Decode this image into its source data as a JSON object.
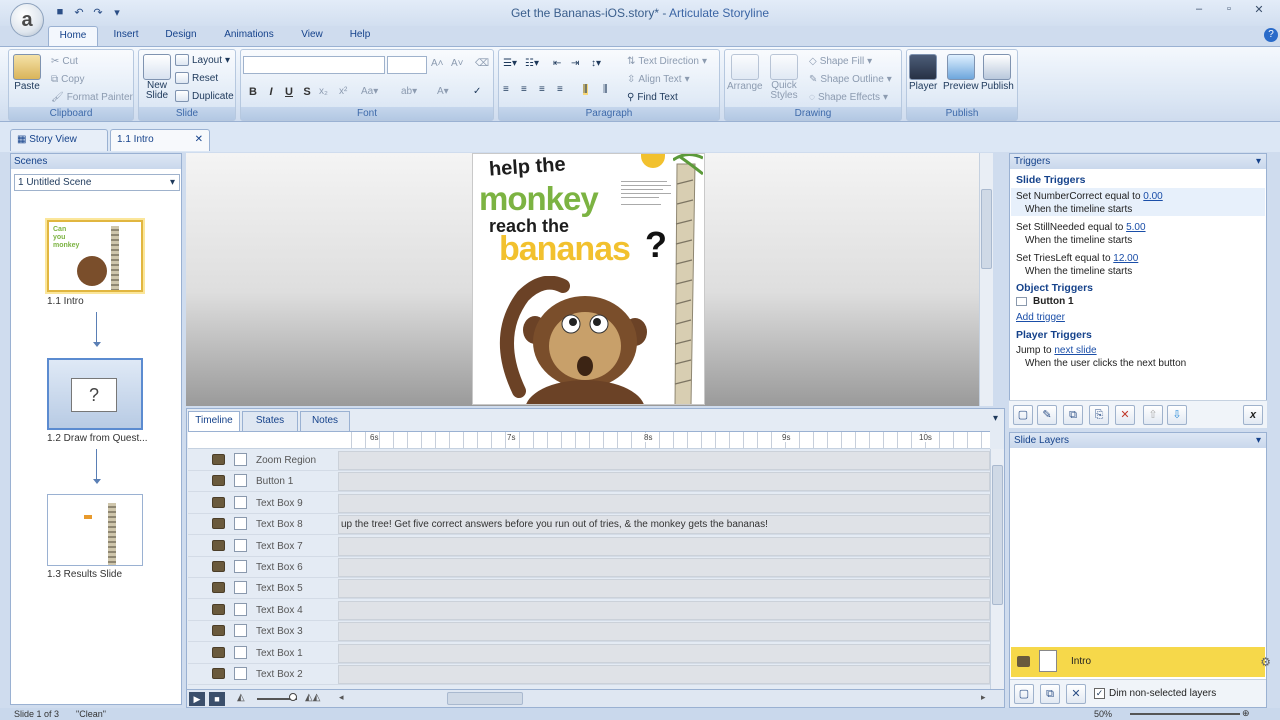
{
  "window": {
    "title": "Get the Bananas-iOS.story* - ",
    "app_name": "Articulate Storyline",
    "controls": [
      "–",
      "▫",
      "✕"
    ]
  },
  "qat": {
    "save_icon": "save-icon",
    "undo_icon": "undo-icon",
    "redo_icon": "redo-icon"
  },
  "ribbon_tabs": [
    "Home",
    "Insert",
    "Design",
    "Animations",
    "View",
    "Help"
  ],
  "ribbon": {
    "clipboard": {
      "paste": "Paste",
      "cut": "Cut",
      "copy": "Copy",
      "format_painter": "Format Painter",
      "group": "Clipboard"
    },
    "slide": {
      "new_slide": "New Slide",
      "layout": "Layout",
      "reset": "Reset",
      "duplicate": "Duplicate",
      "group": "Slide"
    },
    "font": {
      "group": "Font",
      "bold": "B",
      "italic": "I",
      "underline": "U",
      "strike": "S"
    },
    "paragraph": {
      "text_direction": "Text Direction",
      "align_text": "Align Text",
      "find_text": "Find Text",
      "group": "Paragraph"
    },
    "drawing": {
      "arrange": "Arrange",
      "quick_styles": "Quick Styles",
      "shape_fill": "Shape Fill",
      "shape_outline": "Shape Outline",
      "shape_effects": "Shape Effects",
      "group": "Drawing"
    },
    "publish": {
      "player": "Player",
      "preview": "Preview",
      "publish": "Publish",
      "group": "Publish"
    }
  },
  "doc_tabs": {
    "story_view": "Story View",
    "intro": "1.1 Intro"
  },
  "scenes": {
    "header": "Scenes",
    "selected": "1 Untitled Scene",
    "slides": [
      {
        "label": "1.1 Intro"
      },
      {
        "label": "1.2 Draw from Quest..."
      },
      {
        "label": "1.3 Results Slide"
      }
    ]
  },
  "slide_content": {
    "line1": "help the",
    "line2": "monkey",
    "line3": "reach the",
    "line4": "bananas",
    "question_mark": "?"
  },
  "timeline": {
    "tabs": [
      "Timeline",
      "States",
      "Notes"
    ],
    "ruler": [
      "6s",
      "7s",
      "8s",
      "9s",
      "10s"
    ],
    "rows": [
      {
        "name": "Zoom Region",
        "text": ""
      },
      {
        "name": "Button 1",
        "text": ""
      },
      {
        "name": "Text Box 9",
        "text": ""
      },
      {
        "name": "Text Box 8",
        "text": "up the tree! Get five correct answers before you run out of tries, & the monkey gets the bananas!"
      },
      {
        "name": "Text Box 7",
        "text": ""
      },
      {
        "name": "Text Box 6",
        "text": ""
      },
      {
        "name": "Text Box 5",
        "text": ""
      },
      {
        "name": "Text Box 4",
        "text": ""
      },
      {
        "name": "Text Box 3",
        "text": ""
      },
      {
        "name": "Text Box 1",
        "text": ""
      },
      {
        "name": "Text Box 2",
        "text": ""
      }
    ]
  },
  "triggers": {
    "header": "Triggers",
    "slide_triggers": "Slide Triggers",
    "t1_pre": "Set NumberCorrect equal to ",
    "t1_val": "0.00",
    "t1_when": "When the timeline starts",
    "t2_pre": "Set StillNeeded equal to ",
    "t2_val": "5.00",
    "t2_when": "When the timeline starts",
    "t3_pre": "Set TriesLeft equal to ",
    "t3_val": "12.00",
    "t3_when": "When the timeline starts",
    "object_triggers": "Object Triggers",
    "button1": "Button 1",
    "add_trigger": "Add trigger",
    "player_triggers": "Player Triggers",
    "pt_pre": "Jump to ",
    "pt_link": "next slide",
    "pt_when": "When the user clicks the next button"
  },
  "layers": {
    "header": "Slide Layers",
    "base": "Intro",
    "dim_label": "Dim non-selected layers"
  },
  "status": {
    "slide": "Slide 1 of 3",
    "theme": "\"Clean\"",
    "zoom": "50%"
  },
  "colors": {
    "accent": "#15428b",
    "banana_yellow": "#f2c12e",
    "monkey_green": "#7cb342",
    "layer_highlight": "#f6d84a"
  }
}
